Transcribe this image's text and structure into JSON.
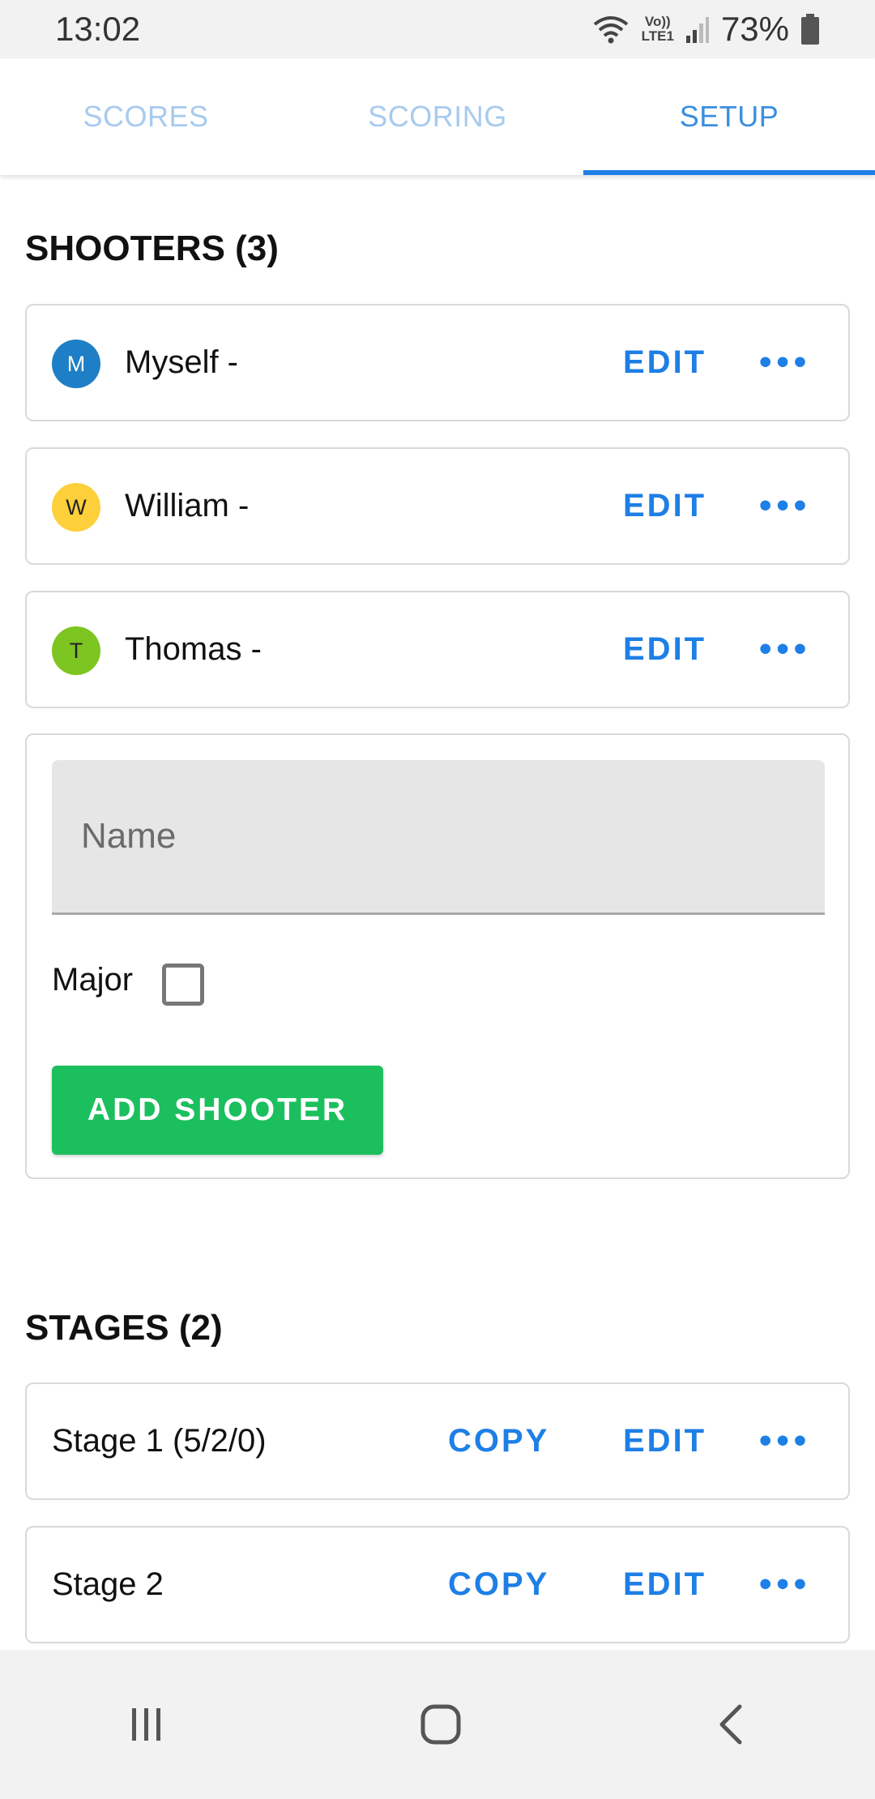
{
  "status": {
    "time": "13:02",
    "network_label_top": "Vo))",
    "network_label_bottom": "LTE1",
    "battery": "73%"
  },
  "tabs": [
    {
      "label": "SCORES"
    },
    {
      "label": "SCORING"
    },
    {
      "label": "SETUP"
    }
  ],
  "shooters": {
    "title": "SHOOTERS (3)",
    "items": [
      {
        "initial": "M",
        "name": "Myself -",
        "avatar_color": "#1e7fc6"
      },
      {
        "initial": "W",
        "name": "William -",
        "avatar_color": "#fdd03b"
      },
      {
        "initial": "T",
        "name": "Thomas -",
        "avatar_color": "#7dc520"
      }
    ],
    "edit_label": "EDIT",
    "more_label": "•••"
  },
  "add_shooter": {
    "name_placeholder": "Name",
    "major_label": "Major",
    "major_checked": false,
    "button_label": "ADD SHOOTER"
  },
  "stages": {
    "title": "STAGES (2)",
    "items": [
      {
        "name": "Stage 1 (5/2/0)"
      },
      {
        "name": "Stage 2"
      }
    ],
    "copy_label": "COPY",
    "edit_label": "EDIT",
    "more_label": "•••"
  },
  "colors": {
    "accent": "#1e7fe6",
    "add_button": "#1cbf5e"
  }
}
